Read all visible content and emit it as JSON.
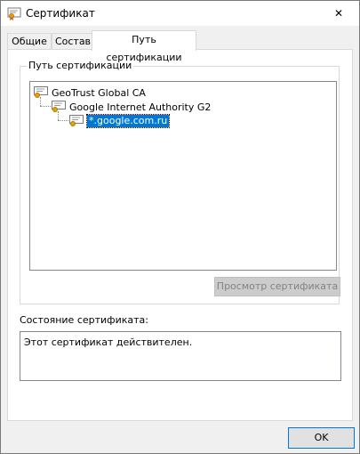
{
  "window": {
    "title": "Сертификат",
    "close_glyph": "✕"
  },
  "tabs": [
    {
      "label": "Общие",
      "active": false
    },
    {
      "label": "Состав",
      "active": false
    },
    {
      "label": "Путь сертификации",
      "active": true
    }
  ],
  "cert_path": {
    "group_label": "Путь сертификации",
    "chain": [
      {
        "label": "GeoTrust Global CA",
        "selected": false,
        "icon": "certificate-icon"
      },
      {
        "label": "Google Internet Authority G2",
        "selected": false,
        "icon": "certificate-icon"
      },
      {
        "label": "*.google.com.ru",
        "selected": true,
        "icon": "certificate-icon"
      }
    ],
    "view_button_label": "Просмотр сертификата",
    "view_button_enabled": false
  },
  "status": {
    "label": "Состояние сертификата:",
    "text": "Этот сертификат действителен."
  },
  "footer": {
    "ok_label": "OK"
  },
  "colors": {
    "selection": "#0078d7",
    "accent": "#0078d7",
    "cert_seal": "#e8a000"
  }
}
